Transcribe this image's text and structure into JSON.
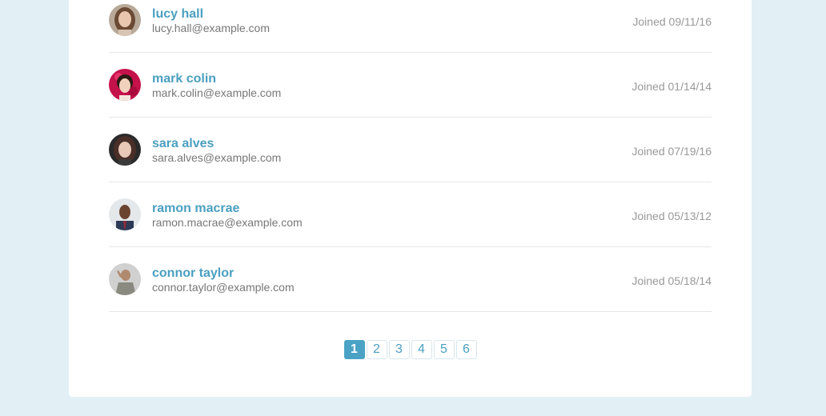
{
  "users": [
    {
      "name": "lucy hall",
      "email": "lucy.hall@example.com",
      "joined": "Joined 09/11/16",
      "avatar_icon": "user-photo-icon"
    },
    {
      "name": "mark colin",
      "email": "mark.colin@example.com",
      "joined": "Joined 01/14/14",
      "avatar_icon": "user-photo-icon"
    },
    {
      "name": "sara alves",
      "email": "sara.alves@example.com",
      "joined": "Joined 07/19/16",
      "avatar_icon": "user-photo-icon"
    },
    {
      "name": "ramon macrae",
      "email": "ramon.macrae@example.com",
      "joined": "Joined 05/13/12",
      "avatar_icon": "user-photo-icon"
    },
    {
      "name": "connor taylor",
      "email": "connor.taylor@example.com",
      "joined": "Joined 05/18/14",
      "avatar_icon": "user-photo-icon"
    }
  ],
  "pagination": {
    "pages": [
      "1",
      "2",
      "3",
      "4",
      "5",
      "6"
    ],
    "current": "1"
  },
  "colors": {
    "background": "#e2f0f6",
    "accent": "#4aa3c4",
    "name_link": "#4a9fc0",
    "muted_text": "#999999"
  }
}
